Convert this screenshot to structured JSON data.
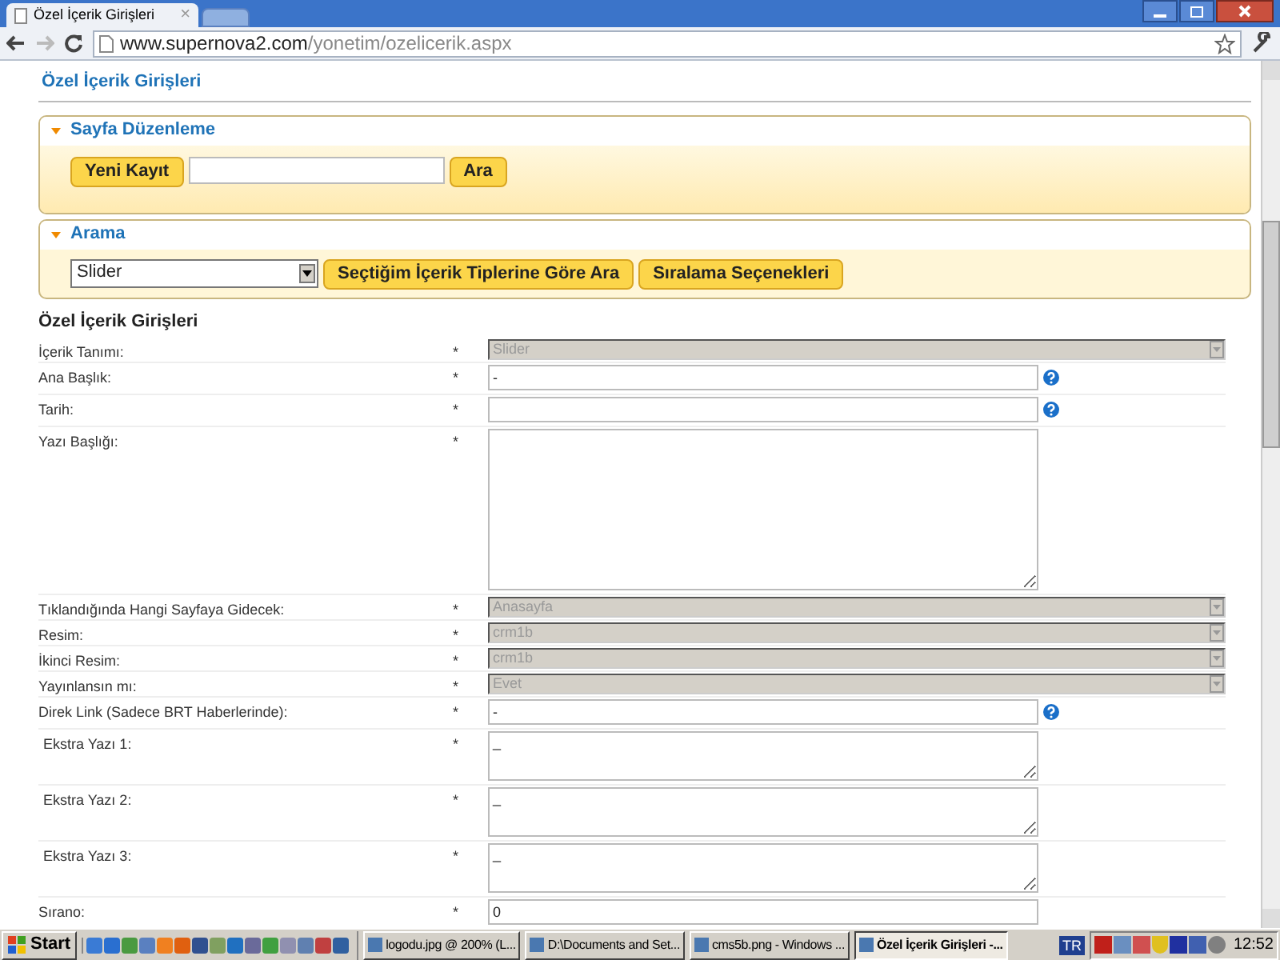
{
  "browser": {
    "tabs": [
      {
        "title": "Özel İçerik Girişleri",
        "selected": true
      }
    ],
    "close_glyph": "×",
    "address": {
      "host": "www.supernova2.com",
      "path": "/yonetim/ozelicerik.aspx"
    }
  },
  "page": {
    "title": "Özel İçerik Girişleri",
    "panels": [
      {
        "title": "Sayfa Düzenleme",
        "controls": [
          {
            "kind": "button",
            "label": "Yeni Kayıt"
          },
          {
            "kind": "input"
          },
          {
            "kind": "button",
            "label": "Ara"
          }
        ]
      },
      {
        "title": "Arama",
        "controls": [
          {
            "kind": "select",
            "value": "Slider"
          },
          {
            "kind": "button",
            "label": "Seçtiğim İçerik Tiplerine Göre Ara"
          },
          {
            "kind": "button",
            "label": "Sıralama Seçenekleri"
          }
        ]
      }
    ],
    "form": {
      "title": "Özel İçerik Girişleri",
      "rows": [
        {
          "label": "İçerik Tanımı:",
          "required": "*",
          "kind": "select",
          "value": "Slider",
          "help": false
        },
        {
          "label": "Ana Başlık:",
          "required": "*",
          "kind": "input",
          "value": "-",
          "help": true
        },
        {
          "label": "Tarih:",
          "required": "*",
          "kind": "input",
          "value": "",
          "help": true
        },
        {
          "label": "Yazı Başlığı:",
          "required": "*",
          "kind": "textarea",
          "value": "",
          "help": false
        },
        {
          "label": "Tıklandığında Hangi Sayfaya Gidecek:",
          "required": "*",
          "kind": "select",
          "value": "Anasayfa",
          "help": false
        },
        {
          "label": "Resim:",
          "required": "*",
          "kind": "select",
          "value": "crm1b",
          "help": false
        },
        {
          "label": "İkinci Resim:",
          "required": "*",
          "kind": "select",
          "value": "crm1b",
          "help": false
        },
        {
          "label": "Yayınlansın mı:",
          "required": "*",
          "kind": "select",
          "value": "Evet",
          "help": false
        },
        {
          "label": "Direk Link (Sadece BRT Haberlerinde):",
          "required": "*",
          "kind": "input",
          "value": "-",
          "help": true
        },
        {
          "label": "Ekstra Yazı 1:",
          "required": "*",
          "kind": "small_textarea",
          "value": "_",
          "help": false
        },
        {
          "label": "Ekstra Yazı 2:",
          "required": "*",
          "kind": "small_textarea",
          "value": "_",
          "help": false
        },
        {
          "label": "Ekstra Yazı 3:",
          "required": "*",
          "kind": "small_textarea",
          "value": "_",
          "help": false
        },
        {
          "label": "Sırano:",
          "required": "*",
          "kind": "input",
          "value": "0",
          "help": false
        }
      ]
    }
  },
  "taskbar": {
    "start": "Start",
    "tasks": [
      {
        "label": "logodu.jpg @ 200% (L...",
        "selected": false
      },
      {
        "label": "D:\\Documents and Set...",
        "selected": false
      },
      {
        "label": "cms5b.png - Windows ...",
        "selected": false
      },
      {
        "label": "Özel İçerik Girişleri -...",
        "selected": true
      }
    ],
    "language": "TR",
    "clock": "12:52"
  }
}
